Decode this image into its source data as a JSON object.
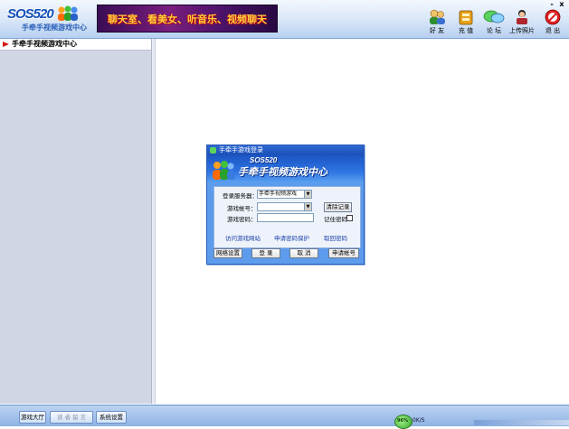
{
  "app": {
    "logo_text": "SOS520",
    "logo_subtitle": "手牵手视频游戏中心",
    "banner_text": "聊天室、看美女、听音乐、视频聊天"
  },
  "toolbar": [
    {
      "label": "好 友",
      "icon": "friends-icon"
    },
    {
      "label": "充 值",
      "icon": "recharge-icon"
    },
    {
      "label": "论 坛",
      "icon": "forum-icon"
    },
    {
      "label": "上传照片",
      "icon": "upload-photo-icon"
    },
    {
      "label": "退 出",
      "icon": "exit-icon"
    }
  ],
  "window_controls": {
    "minimize": "-",
    "close": "x"
  },
  "sidebar": {
    "title": "手牵手视频游戏中心"
  },
  "login": {
    "title": "手牵手游戏登录",
    "banner_small": "SOS520",
    "banner_big": "手牵手视频游戏中心",
    "server_label": "登录服务器：",
    "server_value": "手牵手视频游戏",
    "account_label": "游戏帐号：",
    "account_value": "",
    "password_label": "游戏密码：",
    "password_value": "",
    "clear_button": "清除记录",
    "remember_label": "记住密码",
    "remember_checked": false,
    "links": [
      "访问游戏网站",
      "申请密码保护",
      "取回密码"
    ],
    "buttons": [
      "网络设置",
      "登 录",
      "取 消",
      "申请帐号"
    ]
  },
  "bottom": {
    "tabs": [
      {
        "label": "游戏大厅",
        "enabled": true
      },
      {
        "label": "读 者 留 言",
        "enabled": false
      },
      {
        "label": "系统设置",
        "enabled": true
      }
    ],
    "status_badge": "96%",
    "status_text": "0K/S"
  }
}
